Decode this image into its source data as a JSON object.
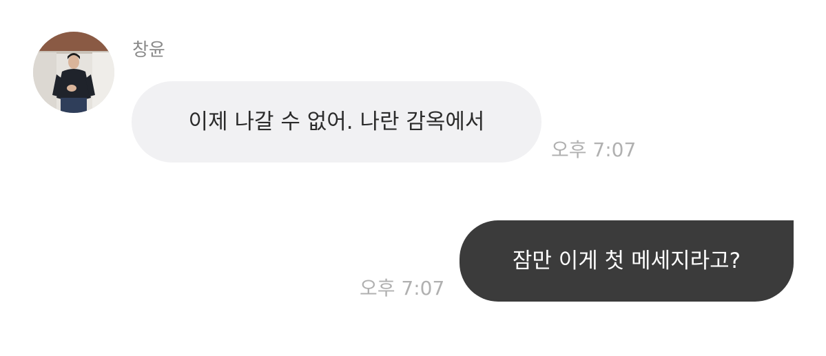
{
  "conversation": {
    "incoming": {
      "sender_name": "창윤",
      "avatar_icon": "profile-photo",
      "message": "이제 나갈 수 없어. 나란 감옥에서",
      "time": "오후 7:07"
    },
    "outgoing": {
      "message": "잠만 이게 첫 메세지라고?",
      "time": "오후 7:07"
    }
  },
  "colors": {
    "incoming_bubble": "#f1f1f3",
    "outgoing_bubble": "#3b3b3b",
    "timestamp": "#b0b0b0",
    "name": "#8a8a8a"
  }
}
